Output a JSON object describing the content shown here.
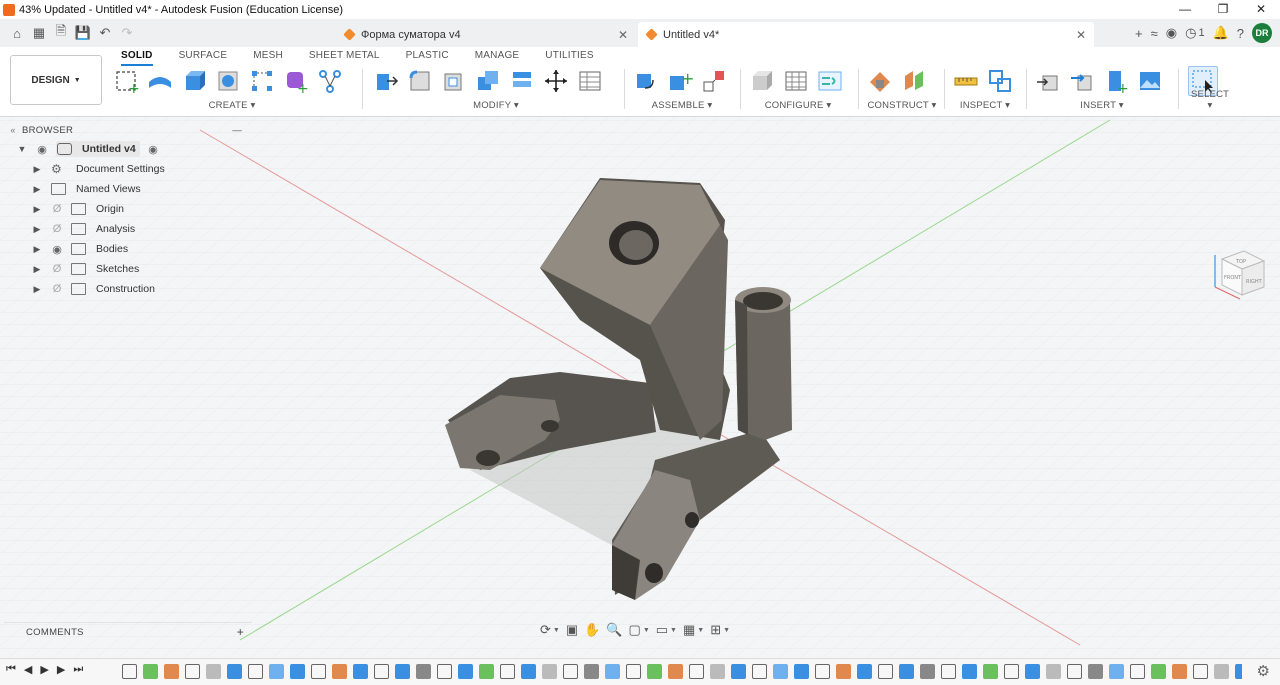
{
  "window": {
    "title": "43% Updated - Untitled v4* - Autodesk Fusion (Education License)",
    "controls": [
      "minimize-icon",
      "restore-icon",
      "close-icon"
    ]
  },
  "tabs": {
    "inactive": {
      "label": "Форма суматора v4"
    },
    "active": {
      "label": "Untitled v4*"
    },
    "job_count": "1",
    "user_initials": "DR"
  },
  "workspace": {
    "label": "DESIGN"
  },
  "ribbon_tabs": [
    "SOLID",
    "SURFACE",
    "MESH",
    "SHEET METAL",
    "PLASTIC",
    "MANAGE",
    "UTILITIES"
  ],
  "groups": {
    "create": "CREATE",
    "modify": "MODIFY",
    "assemble": "ASSEMBLE",
    "configure": "CONFIGURE",
    "construct": "CONSTRUCT",
    "inspect": "INSPECT",
    "insert": "INSERT",
    "select": "SELECT"
  },
  "browser": {
    "header": "BROWSER",
    "root": "Untitled v4",
    "items": [
      {
        "label": "Document Settings",
        "icon": "gear-icon"
      },
      {
        "label": "Named Views",
        "icon": "folder-icon"
      },
      {
        "label": "Origin",
        "icon": "folder-icon",
        "visible": false
      },
      {
        "label": "Analysis",
        "icon": "folder-icon",
        "visible": false
      },
      {
        "label": "Bodies",
        "icon": "folder-icon",
        "visible": true
      },
      {
        "label": "Sketches",
        "icon": "folder-icon",
        "visible": false
      },
      {
        "label": "Construction",
        "icon": "folder-icon",
        "visible": false
      }
    ]
  },
  "comments": {
    "header": "COMMENTS"
  },
  "viewcube": {
    "faces": [
      "TOP",
      "FRONT",
      "RIGHT"
    ]
  },
  "colors": {
    "accent": "#1a7fd6",
    "model": "#6e6a64",
    "x_axis": "#e06666",
    "y_axis": "#6ccf5f",
    "avatar": "#1b7f3b"
  }
}
